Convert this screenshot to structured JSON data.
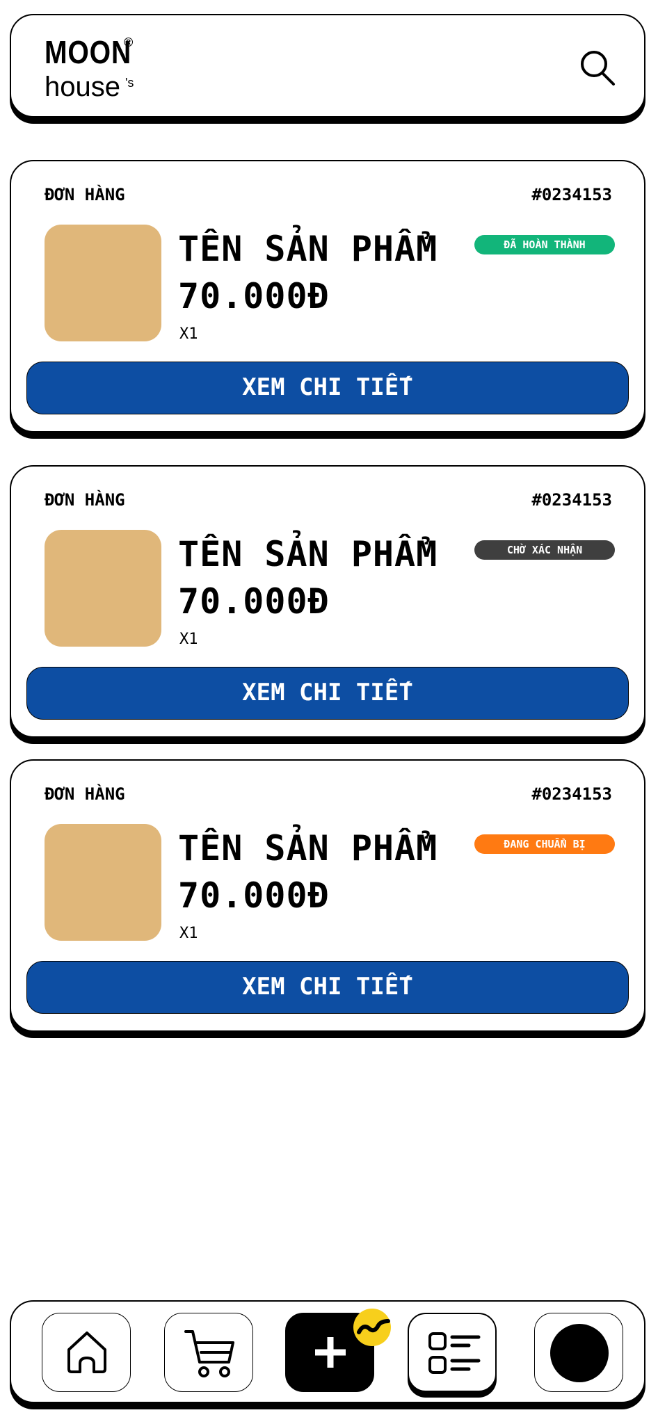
{
  "brand": {
    "logo_top": "MOON",
    "logo_reg": "®",
    "logo_apos": "'s",
    "logo_bottom": "house"
  },
  "header": {
    "search_icon": "search-icon"
  },
  "orders": [
    {
      "label": "ĐƠN HÀNG",
      "order_id": "#0234153",
      "product_name": "TÊN SẢN PHẨM",
      "price": "70.000Đ",
      "quantity": "X1",
      "status": "ĐÃ HOÀN THÀNH",
      "status_color": "#12b57a",
      "thumb_color": "#e0b77a",
      "button_label": "XEM CHI TIẾT"
    },
    {
      "label": "ĐƠN HÀNG",
      "order_id": "#0234153",
      "product_name": "TÊN SẢN PHẨM",
      "price": "70.000Đ",
      "quantity": "X1",
      "status": "CHỜ XÁC NHẬN",
      "status_color": "#3f3f3f",
      "thumb_color": "#e0b77a",
      "button_label": "XEM CHI TIẾT"
    },
    {
      "label": "ĐƠN HÀNG",
      "order_id": "#0234153",
      "product_name": "TÊN SẢN PHẨM",
      "price": "70.000Đ",
      "quantity": "X1",
      "status": "ĐANG CHUẨN BỊ",
      "status_color": "#ff7a12",
      "thumb_color": "#e0b77a",
      "button_label": "XEM CHI TIẾT"
    }
  ],
  "colors": {
    "primary_button": "#0d4ea3",
    "accent_yellow": "#f7cf1c"
  },
  "bottom_nav": {
    "items": [
      {
        "icon": "home-icon"
      },
      {
        "icon": "cart-icon"
      },
      {
        "icon": "plus-icon"
      },
      {
        "icon": "orders-list-icon"
      },
      {
        "icon": "profile-avatar-icon"
      }
    ]
  }
}
